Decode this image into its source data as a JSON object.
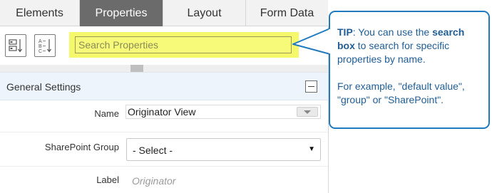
{
  "tabs": [
    {
      "label": "Elements",
      "active": false
    },
    {
      "label": "Properties",
      "active": true
    },
    {
      "label": "Layout",
      "active": false
    },
    {
      "label": "Form Data",
      "active": false
    }
  ],
  "toolbar": {
    "categorized_icon": "categorized-view-icon",
    "alphabetical_icon": "alphabetical-sort-icon",
    "search_placeholder": "Search Properties",
    "search_highlight_color": "#f5f86a"
  },
  "section": {
    "title": "General Settings",
    "collapse_icon": "collapse-minus-icon"
  },
  "properties": {
    "name": {
      "label": "Name",
      "value": "Originator View"
    },
    "sharepoint_group": {
      "label": "SharePoint Group",
      "value": "- Select -"
    },
    "label": {
      "label": "Label",
      "placeholder": "Originator"
    }
  },
  "tip": {
    "lead": "TIP",
    "text_1": ": You can use the ",
    "bold_1": "search box",
    "text_2": " to search  for specific properties by name.",
    "example": "For example, \"default value\", \"group\" or \"SharePoint\".",
    "border_color": "#1f7abf",
    "text_color": "#1f5d96"
  },
  "colors": {
    "active_tab_bg": "#6b6b6b",
    "section_header_bg": "#edf4fb"
  }
}
